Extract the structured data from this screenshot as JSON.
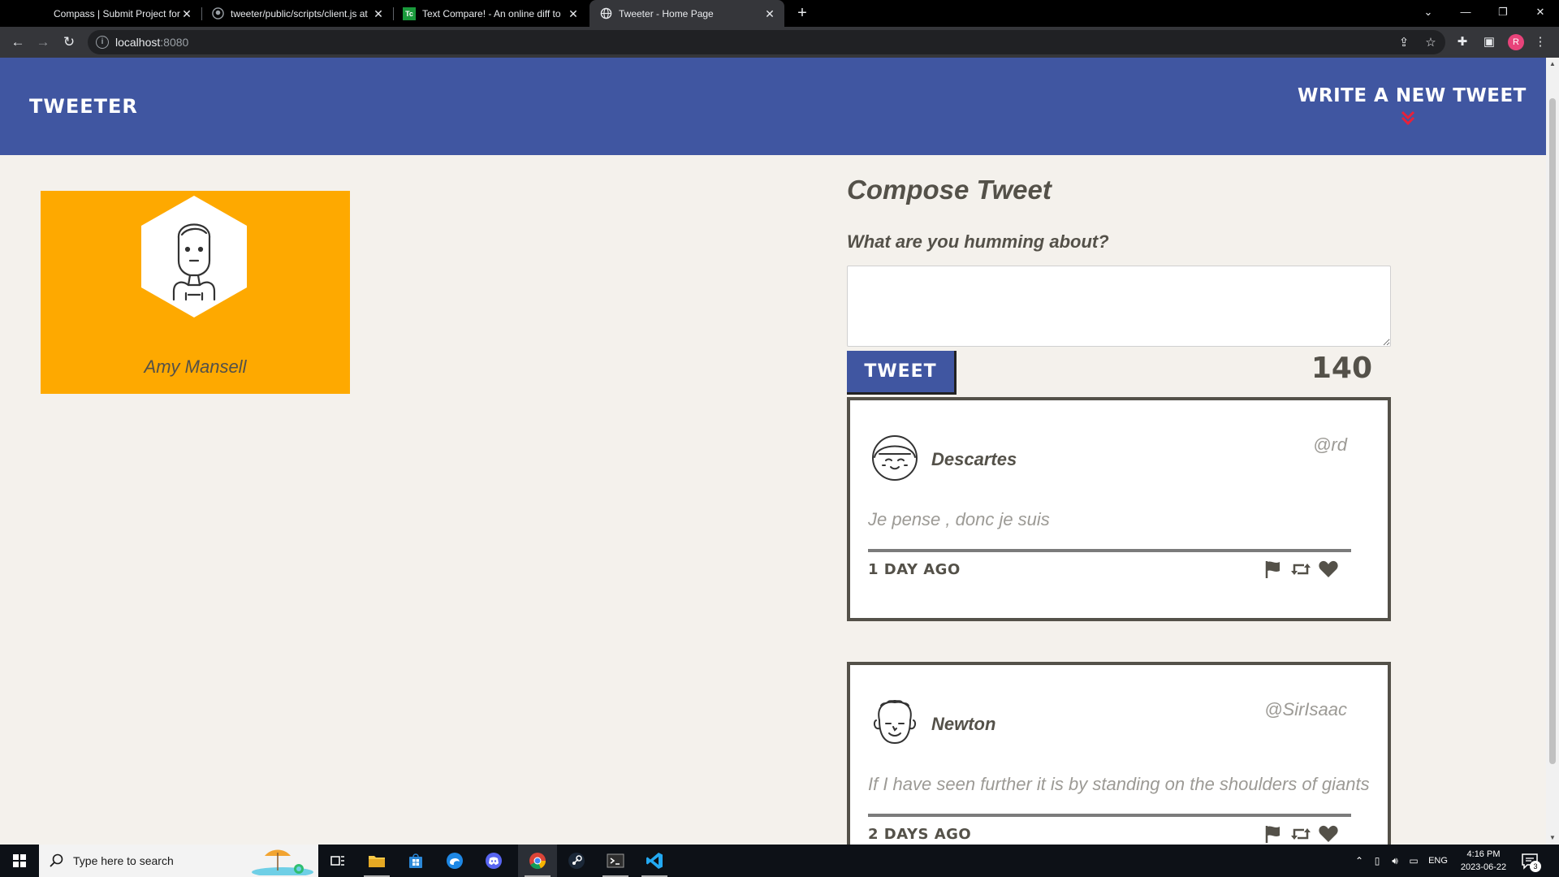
{
  "browser": {
    "tabs": [
      {
        "title": "Compass | Submit Project for Eva",
        "active": false,
        "favicon": "compass-icon"
      },
      {
        "title": "tweeter/public/scripts/client.js at",
        "active": false,
        "favicon": "github-icon"
      },
      {
        "title": "Text Compare! - An online diff to",
        "active": false,
        "favicon": "textcompare-icon",
        "favicon_text": "Tc"
      },
      {
        "title": "Tweeter - Home Page",
        "active": true,
        "favicon": "globe-icon"
      }
    ],
    "url_host": "localhost",
    "url_port": ":8080",
    "profile_initial": "R"
  },
  "site": {
    "brand": "TWEETER",
    "write_new": "WRITE A NEW TWEET",
    "accent_color": "#4056a1",
    "chevron_color": "#e8213a"
  },
  "profile": {
    "name": "Amy Mansell",
    "card_color": "#fea900"
  },
  "compose": {
    "title": "Compose Tweet",
    "label": "What are you humming about?",
    "value": "",
    "button": "TWEET",
    "counter": "140"
  },
  "tweets": [
    {
      "name": "Descartes",
      "handle": "@rd",
      "content": "Je pense , donc je suis",
      "time": "1 DAY AGO",
      "actions": [
        "flag-icon",
        "retweet-icon",
        "heart-icon"
      ]
    },
    {
      "name": "Newton",
      "handle": "@SirIsaac",
      "content": "If I have seen further it is by standing on the shoulders of giants",
      "time": "2 DAYS AGO",
      "actions": [
        "flag-icon",
        "retweet-icon",
        "heart-icon"
      ]
    }
  ],
  "taskbar": {
    "search_placeholder": "Type here to search",
    "apps": [
      "task-view-icon",
      "file-explorer-icon",
      "store-icon",
      "edge-icon",
      "discord-icon",
      "chrome-icon",
      "steam-icon",
      "terminal-icon",
      "vscode-icon"
    ],
    "lang": "ENG",
    "time": "4:16 PM",
    "date": "2023-06-22",
    "notifications": "3"
  }
}
